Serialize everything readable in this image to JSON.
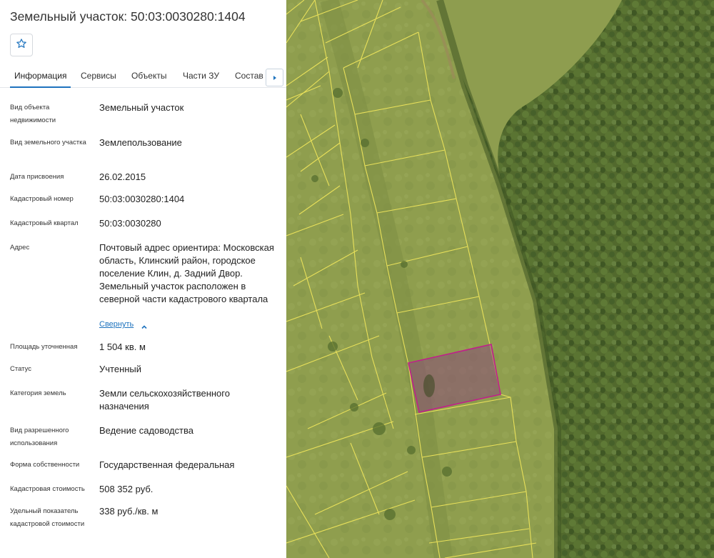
{
  "header": {
    "title": "Земельный участок: 50:03:0030280:1404"
  },
  "favorite": {
    "icon": "star-icon"
  },
  "tabs": [
    {
      "label": "Информация",
      "active": true
    },
    {
      "label": "Сервисы",
      "active": false
    },
    {
      "label": "Объекты",
      "active": false
    },
    {
      "label": "Части ЗУ",
      "active": false
    },
    {
      "label": "Состав ЕЗП",
      "active": false
    }
  ],
  "tab_scroll_icon": "caret-right-icon",
  "fields": [
    {
      "label": "Вид объекта недвижимости",
      "value": "Земельный участок"
    },
    {
      "label": "Вид земельного участка",
      "value": "Землепользование"
    },
    {
      "label": "Дата присвоения",
      "value": "26.02.2015"
    },
    {
      "label": "Кадастровый номер",
      "value": "50:03:0030280:1404"
    },
    {
      "label": "Кадастровый квартал",
      "value": "50:03:0030280"
    },
    {
      "label": "Адрес",
      "value": "Почтовый адрес ориентира: Московская область, Клинский район, городское поселение Клин, д. Задний Двор. Земельный участок расположен в северной части кадастрового квартала"
    },
    {
      "label": "Площадь уточненная",
      "value": "1 504 кв. м"
    },
    {
      "label": "Статус",
      "value": "Учтенный"
    },
    {
      "label": "Категория земель",
      "value": "Земли сельскохозяйственного назначения"
    },
    {
      "label": "Вид разрешенного использования",
      "value": "Ведение садоводства"
    },
    {
      "label": "Форма собственности",
      "value": "Государственная федеральная"
    },
    {
      "label": "Кадастровая стоимость",
      "value": "508 352 руб."
    },
    {
      "label": "Удельный показатель кадастровой стоимости",
      "value": "338 руб./кв. м"
    }
  ],
  "address_toggle": {
    "label": "Свернуть",
    "icon": "chevron-up-icon"
  },
  "colors": {
    "accent": "#1e73be",
    "parcel_outline": "#e8e05a",
    "selected_parcel": "#c0208a",
    "field_green": "#8a9a4a",
    "forest_green": "#4f6a2c"
  }
}
